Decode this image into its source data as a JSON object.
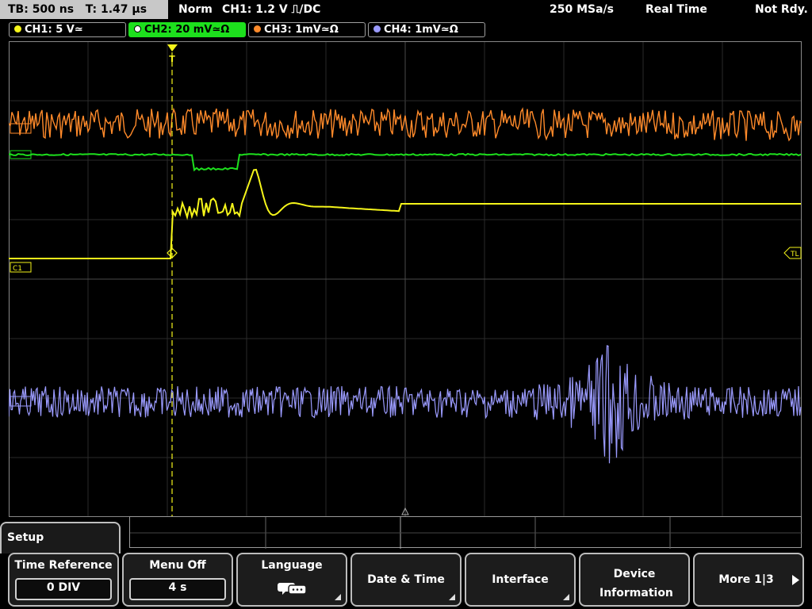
{
  "topbar": {
    "timebase": "TB: 500 ns",
    "time": "T: 1.47 µs",
    "mode": "Norm",
    "trigger": "CH1: 1.2 V ⎍/DC",
    "sample_rate": "250 MSa/s",
    "acq": "Real Time",
    "status": "Not Rdy."
  },
  "channels": [
    {
      "label": "CH1: 5 V≃",
      "color": "#f5f51a"
    },
    {
      "label": "CH2: 20 mV≃Ω",
      "color": "#1de01d"
    },
    {
      "label": "CH3: 1mV≃Ω",
      "color": "#ff8a2a"
    },
    {
      "label": "CH4: 1mV≃Ω",
      "color": "#9b9bff"
    }
  ],
  "markers": {
    "c1": "C1",
    "tl": "TL",
    "trigger": "T"
  },
  "menu": {
    "title": "Setup",
    "softkeys": [
      {
        "label": "Time Reference",
        "value": "0 DIV"
      },
      {
        "label": "Menu Off",
        "value": "4 s"
      },
      {
        "label": "Language",
        "icon": "language-chat-icon"
      },
      {
        "label": "Date & Time"
      },
      {
        "label": "Interface"
      },
      {
        "label": "Device Information"
      },
      {
        "label": "More 1|3"
      }
    ]
  }
}
